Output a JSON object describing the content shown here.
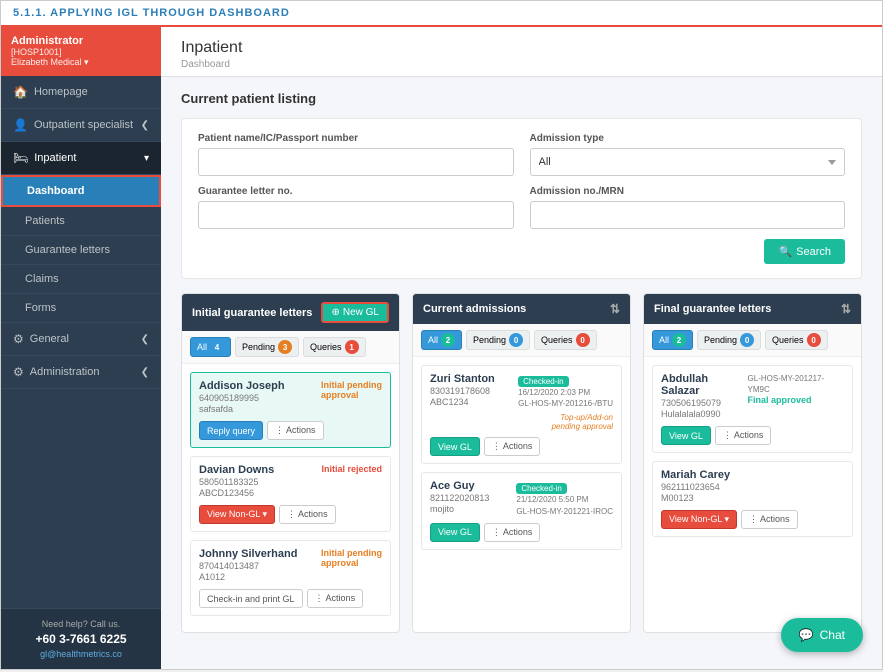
{
  "page": {
    "header_title": "5.1.1.  APPLYING IGL THROUGH DASHBOARD"
  },
  "sidebar": {
    "user": {
      "icon": "🔴",
      "username": "Administrator",
      "hosp_id": "[HOSP1001]",
      "hosp_name": "Elizabeth Medical ▾"
    },
    "nav_items": [
      {
        "id": "homepage",
        "icon": "🏠",
        "label": "Homepage",
        "has_arrow": false
      },
      {
        "id": "outpatient",
        "icon": "👤",
        "label": "Outpatient specialist",
        "has_arrow": true
      },
      {
        "id": "inpatient",
        "icon": "🛏",
        "label": "Inpatient",
        "has_arrow": true,
        "active": true
      }
    ],
    "sub_items": [
      {
        "id": "dashboard",
        "label": "Dashboard",
        "active": true
      },
      {
        "id": "patients",
        "label": "Patients"
      },
      {
        "id": "guarantee_letters",
        "label": "Guarantee letters"
      },
      {
        "id": "claims",
        "label": "Claims"
      },
      {
        "id": "forms",
        "label": "Forms"
      }
    ],
    "bottom_items": [
      {
        "id": "general",
        "icon": "⚙",
        "label": "General",
        "has_arrow": true
      },
      {
        "id": "administration",
        "icon": "⚙",
        "label": "Administration",
        "has_arrow": true
      }
    ],
    "help": {
      "label": "Need help? Call us.",
      "phone": "+60 3-7661 6225",
      "email": "gl@healthmetrics.co"
    }
  },
  "content": {
    "title": "Inpatient",
    "breadcrumb": "Dashboard",
    "search_section": {
      "title": "Current patient listing",
      "fields": {
        "patient_name_label": "Patient name/IC/Passport number",
        "patient_name_placeholder": "",
        "admission_type_label": "Admission type",
        "admission_type_value": "All",
        "guarantee_letter_label": "Guarantee letter no.",
        "guarantee_letter_placeholder": "",
        "admission_no_label": "Admission no./MRN",
        "admission_no_placeholder": ""
      },
      "search_btn": "Search"
    },
    "cards": {
      "initial": {
        "title": "Initial guarantee letters",
        "new_gl_btn": "New GL",
        "filters": [
          {
            "label": "All",
            "count": "4",
            "badge_type": "blue",
            "active": true
          },
          {
            "label": "Pending",
            "count": "3",
            "badge_type": "orange"
          },
          {
            "label": "Queries",
            "count": "1",
            "badge_type": "red"
          }
        ],
        "patients": [
          {
            "name": "Addison Joseph",
            "id1": "640905189995",
            "id2": "safsafda",
            "status": "Initial pending approval",
            "status_type": "pending",
            "highlight": true,
            "actions": [
              {
                "label": "Reply query",
                "type": "reply"
              },
              {
                "label": "⋮ Actions",
                "type": "actions"
              }
            ]
          },
          {
            "name": "Davian Downs",
            "id1": "580501183325",
            "id2": "ABCD123456",
            "status": "Initial rejected",
            "status_type": "rejected",
            "highlight": false,
            "actions": [
              {
                "label": "View Non-GL ▾",
                "type": "view-non-gl"
              },
              {
                "label": "⋮ Actions",
                "type": "actions"
              }
            ]
          },
          {
            "name": "Johnny Silverhand",
            "id1": "870414013487",
            "id2": "A1012",
            "status": "Initial pending approval",
            "status_type": "pending",
            "highlight": false,
            "actions": [
              {
                "label": "Check-in and print GL",
                "type": "checkin"
              },
              {
                "label": "⋮ Actions",
                "type": "actions"
              }
            ]
          }
        ]
      },
      "current": {
        "title": "Current admissions",
        "filters": [
          {
            "label": "All",
            "count": "2",
            "badge_type": "teal",
            "active": true
          },
          {
            "label": "Pending",
            "count": "0",
            "badge_type": "blue"
          },
          {
            "label": "Queries",
            "count": "0",
            "badge_type": "red"
          }
        ],
        "patients": [
          {
            "name": "Zuri Stanton",
            "id1": "830319178608",
            "id2": "ABC1234",
            "checked_in": true,
            "checked_in_date": "16/12/2020 2:03 PM",
            "gl_ref": "GL-HOS-MY-201216-/BTU",
            "pending_note": "Top-up/Add-on pending approval",
            "actions": [
              {
                "label": "View GL",
                "type": "view-gl"
              },
              {
                "label": "⋮ Actions",
                "type": "actions"
              }
            ]
          },
          {
            "name": "Ace Guy",
            "id1": "821122020813",
            "id2": "mojito",
            "checked_in": true,
            "checked_in_date": "21/12/2020 5:50 PM",
            "gl_ref": "GL-HOS-MY-201221-IROC",
            "pending_note": "",
            "actions": [
              {
                "label": "View GL",
                "type": "view-gl"
              },
              {
                "label": "⋮ Actions",
                "type": "actions"
              }
            ]
          }
        ]
      },
      "final": {
        "title": "Final guarantee letters",
        "filters": [
          {
            "label": "All",
            "count": "2",
            "badge_type": "teal",
            "active": true
          },
          {
            "label": "Pending",
            "count": "0",
            "badge_type": "blue"
          },
          {
            "label": "Queries",
            "count": "0",
            "badge_type": "red"
          }
        ],
        "patients": [
          {
            "name": "Abdullah Salazar",
            "id1": "730506195079",
            "id2": "Hulalalala0990",
            "gl_ref": "GL-HOS-MY-201217-YM9C",
            "status": "Final approved",
            "status_type": "approved",
            "actions": [
              {
                "label": "View GL",
                "type": "view-gl"
              },
              {
                "label": "⋮ Actions",
                "type": "actions"
              }
            ]
          },
          {
            "name": "Mariah Carey",
            "id1": "962111023654",
            "id2": "M00123",
            "gl_ref": "",
            "status": "",
            "status_type": "",
            "actions": [
              {
                "label": "View Non-GL ▾",
                "type": "view-non-gl"
              },
              {
                "label": "⋮ Actions",
                "type": "actions"
              }
            ]
          }
        ]
      }
    },
    "chat_btn": "Chat"
  }
}
